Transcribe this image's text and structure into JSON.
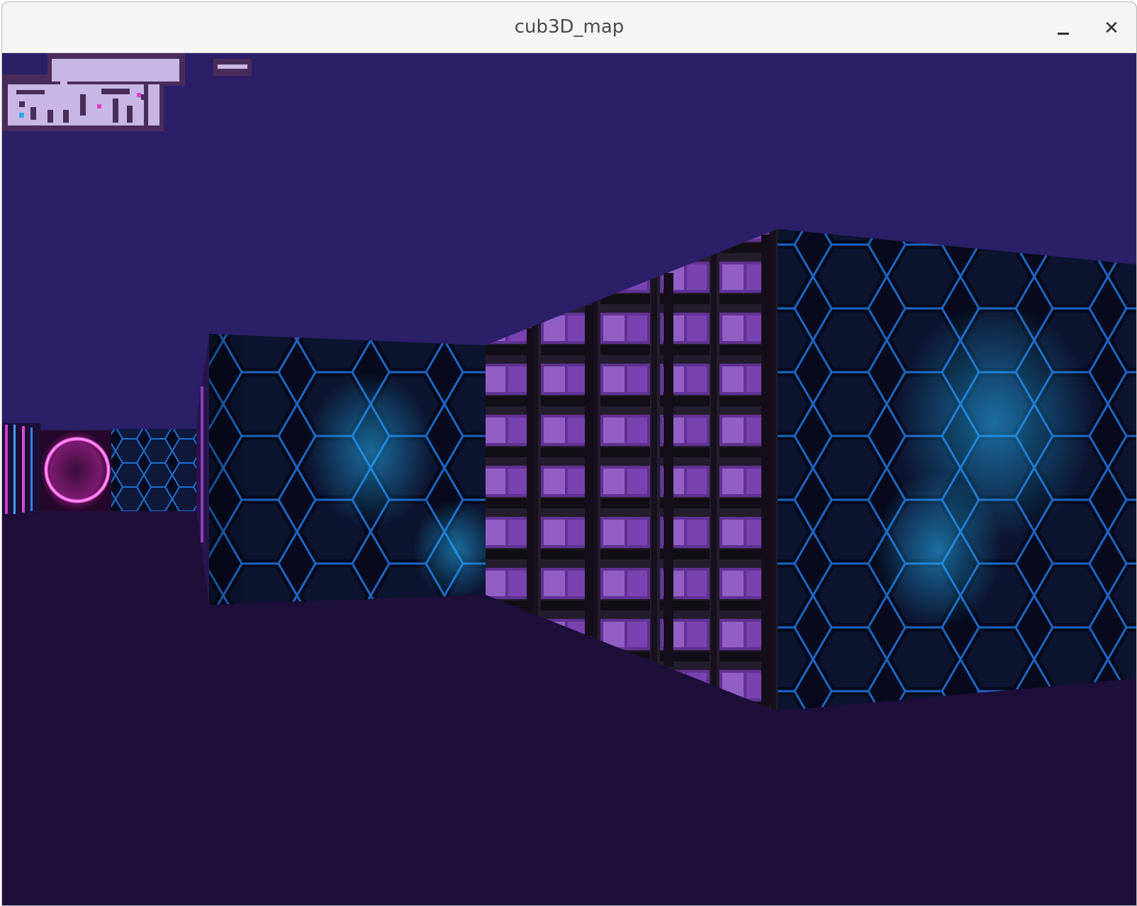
{
  "window": {
    "title": "cub3D_map",
    "minimize_icon": "minimize-icon",
    "close_icon": "close-icon",
    "close_glyph": "✕"
  },
  "scene": {
    "ceiling_color": "#2b1f68",
    "floor_color": "#1e0e3a",
    "textures": [
      "hexagon-blue",
      "neon-ring",
      "purple-windows"
    ]
  },
  "minimap": {
    "wall_color": "#4a2c5a",
    "floor_color": "#c8b6e6",
    "player_color": "#2fa6e8",
    "door_color": "#e23ccf"
  }
}
